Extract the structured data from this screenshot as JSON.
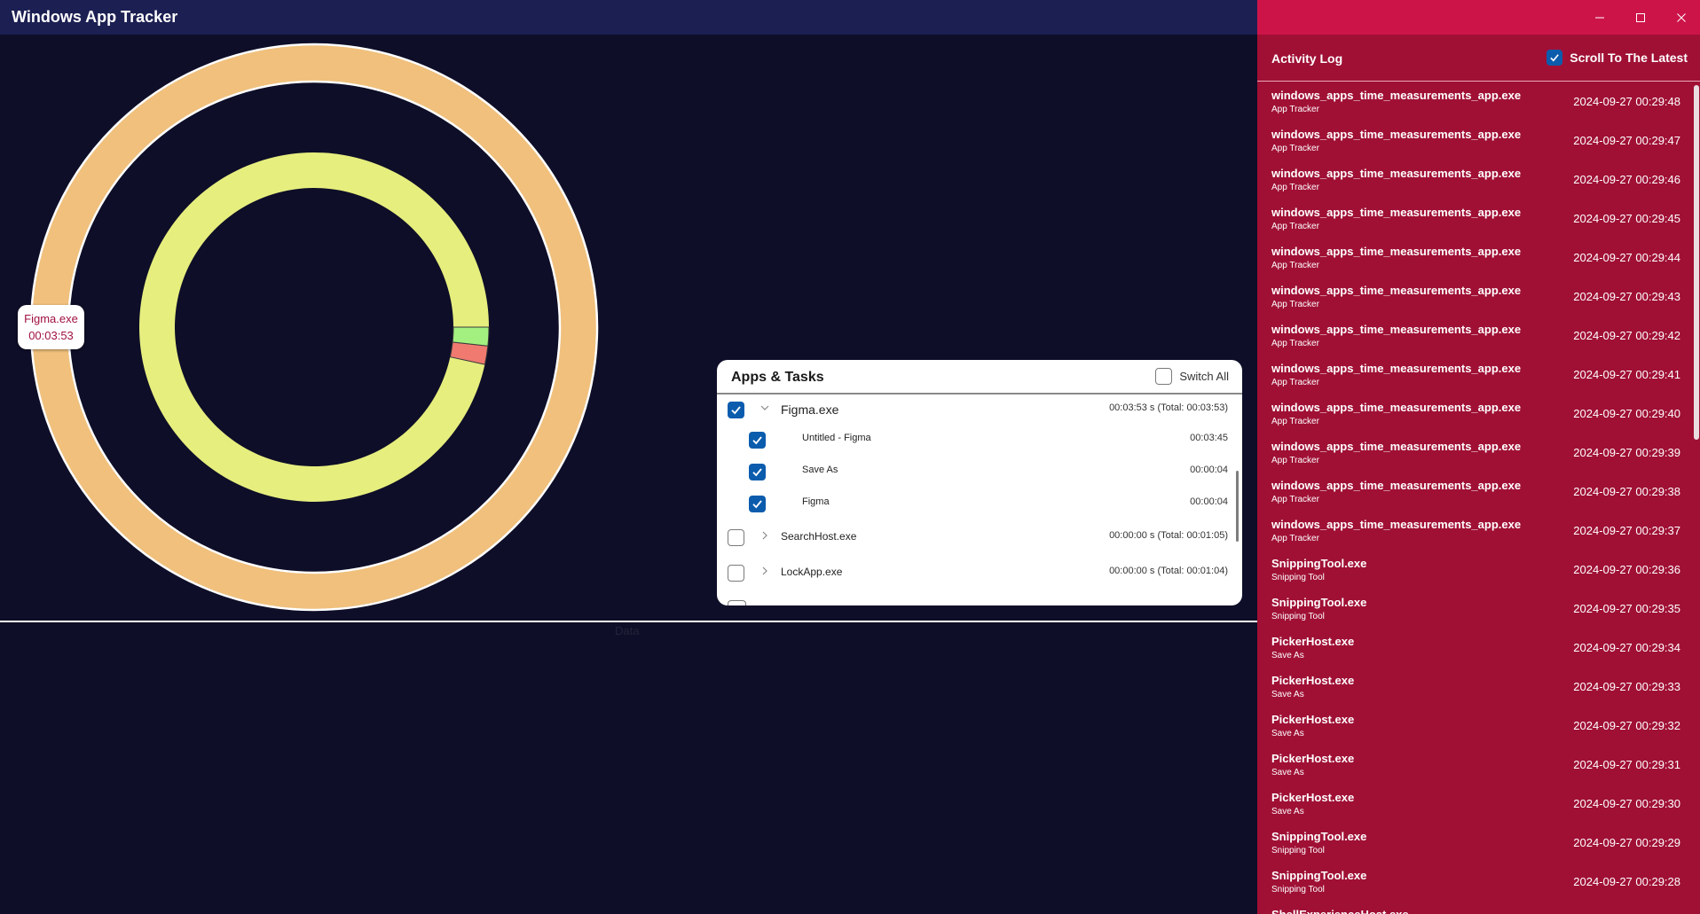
{
  "app": {
    "title": "Windows App Tracker"
  },
  "chart_data": {
    "type": "pie",
    "rings": [
      {
        "name": "apps",
        "slices": [
          {
            "label": "Figma.exe",
            "seconds": 233,
            "color": "#f0c07c"
          }
        ]
      },
      {
        "name": "tasks",
        "slices": [
          {
            "label": "Untitled - Figma",
            "seconds": 225,
            "color": "#e6ee7e"
          },
          {
            "label": "Save As",
            "seconds": 4,
            "color": "#f07a70"
          },
          {
            "label": "Figma",
            "seconds": 4,
            "color": "#a3f080"
          }
        ]
      }
    ],
    "tooltip": {
      "label": "Figma.exe",
      "value": "00:03:53"
    },
    "xlabel": "Data"
  },
  "tasks_panel": {
    "title": "Apps & Tasks",
    "switch_all_label": "Switch All",
    "apps": [
      {
        "name": "Figma.exe",
        "time": "00:03:53 s (Total: 00:03:53)",
        "checked": true,
        "expanded": true,
        "tasks": [
          {
            "name": "Untitled - Figma",
            "time": "00:03:45",
            "checked": true
          },
          {
            "name": "Save As",
            "time": "00:00:04",
            "checked": true
          },
          {
            "name": "Figma",
            "time": "00:00:04",
            "checked": true
          }
        ]
      },
      {
        "name": "SearchHost.exe",
        "time": "00:00:00 s (Total: 00:01:05)",
        "checked": false,
        "expanded": false
      },
      {
        "name": "LockApp.exe",
        "time": "00:00:00 s (Total: 00:01:04)",
        "checked": false,
        "expanded": false
      }
    ]
  },
  "activity_log": {
    "title": "Activity Log",
    "scroll_latest_label": "Scroll To The Latest",
    "scroll_latest_checked": true,
    "entries": [
      {
        "exe": "windows_apps_time_measurements_app.exe",
        "window": "App Tracker",
        "timestamp": "2024-09-27 00:29:48"
      },
      {
        "exe": "windows_apps_time_measurements_app.exe",
        "window": "App Tracker",
        "timestamp": "2024-09-27 00:29:47"
      },
      {
        "exe": "windows_apps_time_measurements_app.exe",
        "window": "App Tracker",
        "timestamp": "2024-09-27 00:29:46"
      },
      {
        "exe": "windows_apps_time_measurements_app.exe",
        "window": "App Tracker",
        "timestamp": "2024-09-27 00:29:45"
      },
      {
        "exe": "windows_apps_time_measurements_app.exe",
        "window": "App Tracker",
        "timestamp": "2024-09-27 00:29:44"
      },
      {
        "exe": "windows_apps_time_measurements_app.exe",
        "window": "App Tracker",
        "timestamp": "2024-09-27 00:29:43"
      },
      {
        "exe": "windows_apps_time_measurements_app.exe",
        "window": "App Tracker",
        "timestamp": "2024-09-27 00:29:42"
      },
      {
        "exe": "windows_apps_time_measurements_app.exe",
        "window": "App Tracker",
        "timestamp": "2024-09-27 00:29:41"
      },
      {
        "exe": "windows_apps_time_measurements_app.exe",
        "window": "App Tracker",
        "timestamp": "2024-09-27 00:29:40"
      },
      {
        "exe": "windows_apps_time_measurements_app.exe",
        "window": "App Tracker",
        "timestamp": "2024-09-27 00:29:39"
      },
      {
        "exe": "windows_apps_time_measurements_app.exe",
        "window": "App Tracker",
        "timestamp": "2024-09-27 00:29:38"
      },
      {
        "exe": "windows_apps_time_measurements_app.exe",
        "window": "App Tracker",
        "timestamp": "2024-09-27 00:29:37"
      },
      {
        "exe": "SnippingTool.exe",
        "window": "Snipping Tool",
        "timestamp": "2024-09-27 00:29:36"
      },
      {
        "exe": "SnippingTool.exe",
        "window": "Snipping Tool",
        "timestamp": "2024-09-27 00:29:35"
      },
      {
        "exe": "PickerHost.exe",
        "window": "Save As",
        "timestamp": "2024-09-27 00:29:34"
      },
      {
        "exe": "PickerHost.exe",
        "window": "Save As",
        "timestamp": "2024-09-27 00:29:33"
      },
      {
        "exe": "PickerHost.exe",
        "window": "Save As",
        "timestamp": "2024-09-27 00:29:32"
      },
      {
        "exe": "PickerHost.exe",
        "window": "Save As",
        "timestamp": "2024-09-27 00:29:31"
      },
      {
        "exe": "PickerHost.exe",
        "window": "Save As",
        "timestamp": "2024-09-27 00:29:30"
      },
      {
        "exe": "SnippingTool.exe",
        "window": "Snipping Tool",
        "timestamp": "2024-09-27 00:29:29"
      },
      {
        "exe": "SnippingTool.exe",
        "window": "Snipping Tool",
        "timestamp": "2024-09-27 00:29:28"
      },
      {
        "exe": "ShellExperienceHost.exe",
        "window": "",
        "timestamp": ""
      }
    ]
  },
  "icons": {
    "minimize": "minimize-icon",
    "maximize": "maximize-icon",
    "close": "close-icon",
    "expand": "chevron-down-icon",
    "collapse": "chevron-right-icon",
    "check": "checkmark-icon"
  }
}
